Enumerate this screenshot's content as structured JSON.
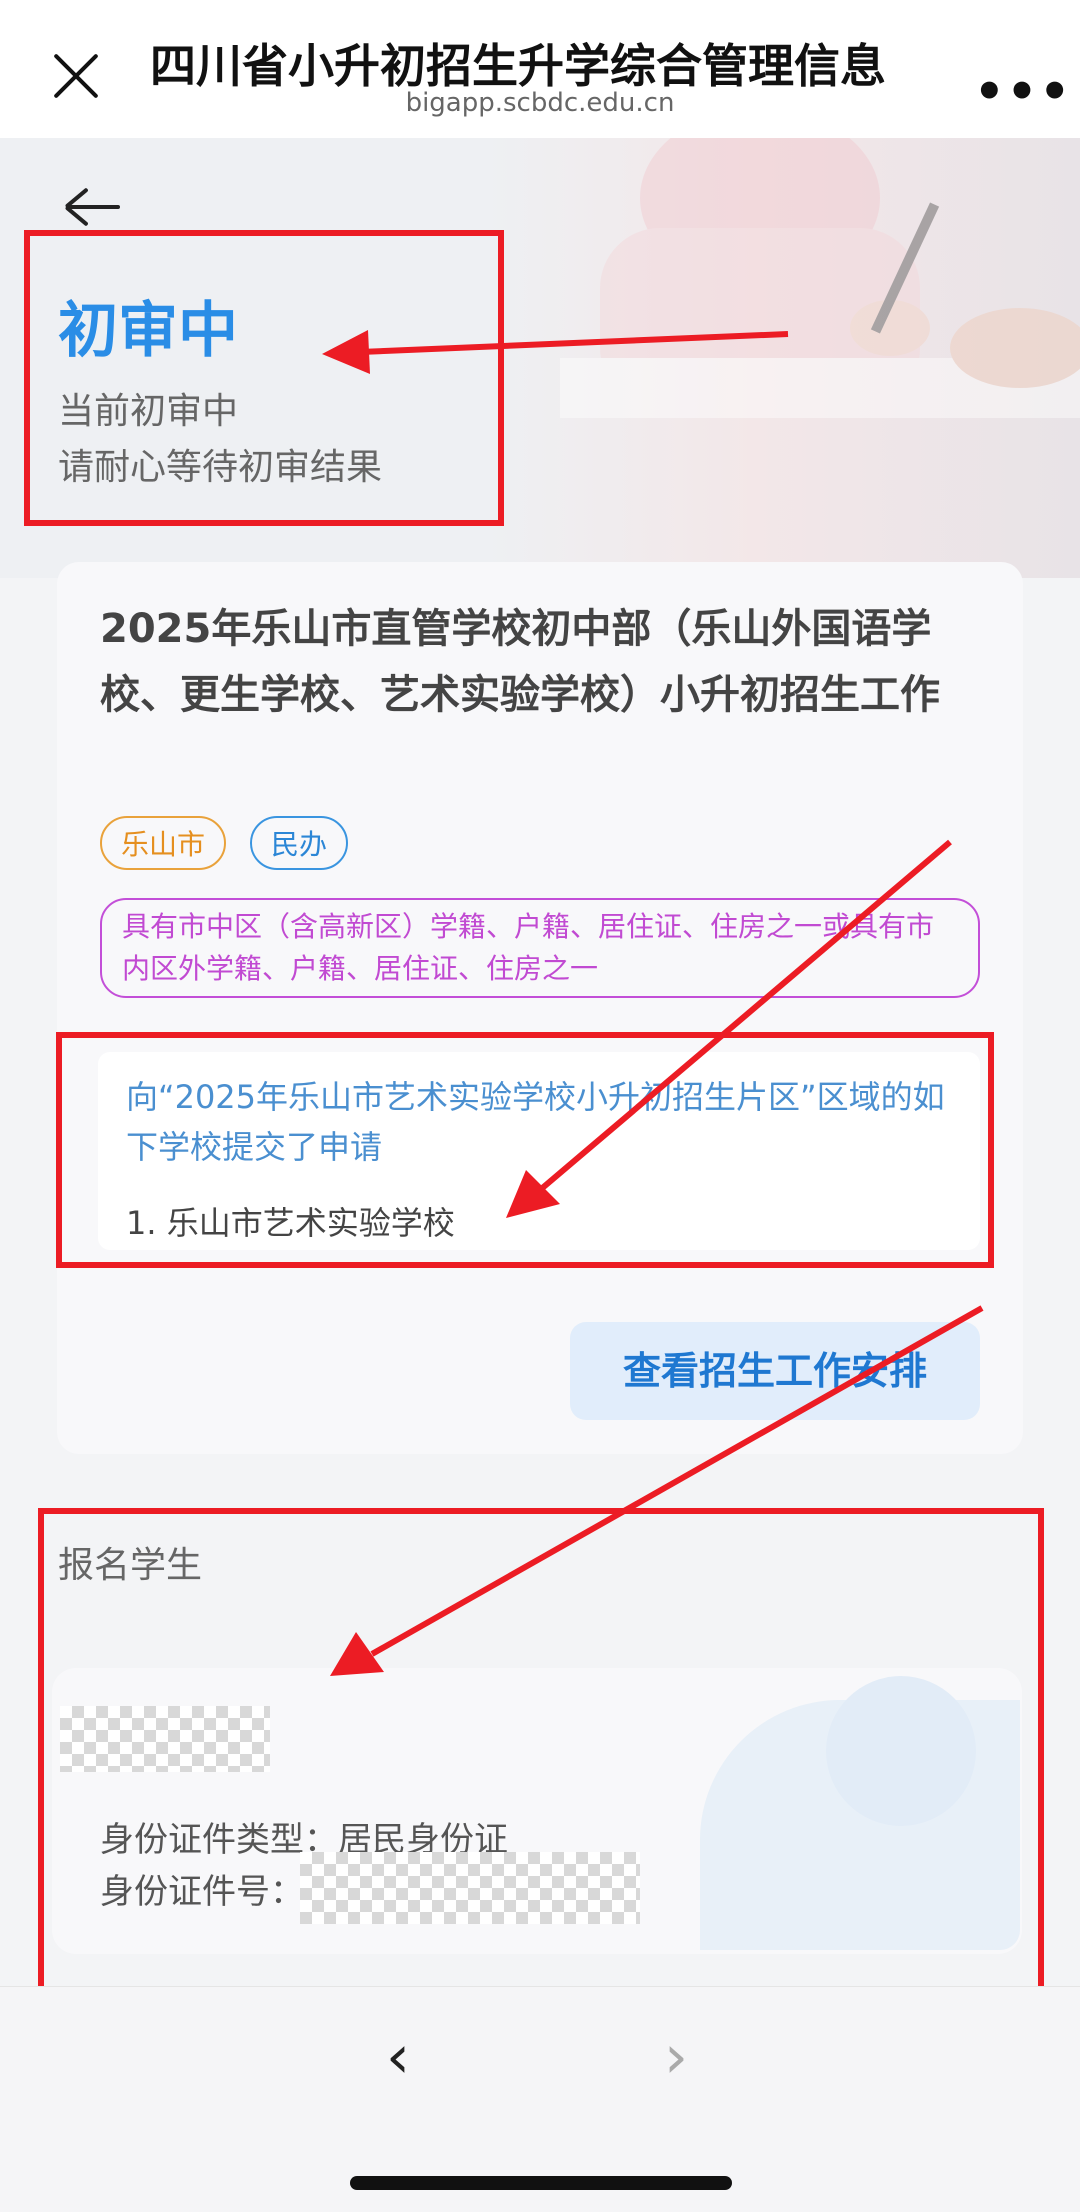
{
  "header": {
    "title": "四川省小升初招生升学综合管理信息",
    "url": "bigapp.scbdc.edu.cn",
    "more_label": "•••"
  },
  "status": {
    "title": "初审中",
    "line1": "当前初审中",
    "line2": "请耐心等待初审结果"
  },
  "work": {
    "title": "2025年乐山市直管学校初中部（乐山外国语学校、更生学校、艺术实验学校）小升初招生工作",
    "tags": [
      "乐山市",
      "民办"
    ],
    "condition": "具有市中区（含高新区）学籍、户籍、居住证、住房之一或具有市内区外学籍、户籍、居住证、住房之一",
    "apply_text": "向“2025年乐山市艺术实验学校小升初招生片区”区域的如下学校提交了申请",
    "apply_item": "1.  乐山市艺术实验学校",
    "view_button": "查看招生工作安排"
  },
  "student": {
    "section_label": "报名学生",
    "id_type": "身份证件类型：居民身份证",
    "id_no_label": "身份证件号："
  },
  "nav": {
    "prev": "‹",
    "next": "›"
  },
  "colors": {
    "accent": "#2a8de6",
    "annotation": "#ec1c24",
    "tag_orange": "#e58f1f",
    "tag_purple": "#c14ad2"
  }
}
